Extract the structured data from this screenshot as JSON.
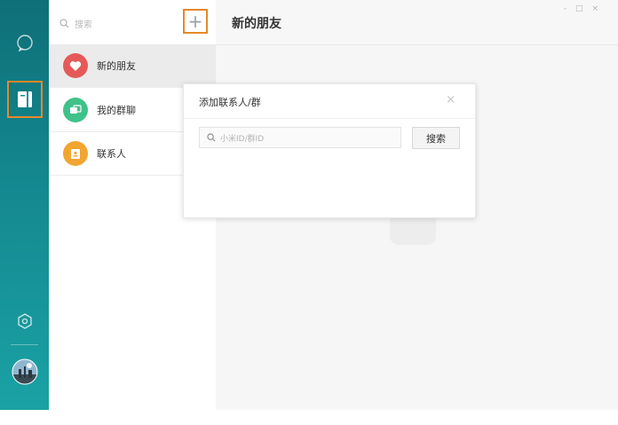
{
  "rail": {
    "icons": [
      "chat-bubble-icon",
      "contacts-book-icon",
      "settings-hexagon-icon",
      "avatar"
    ],
    "active": "contacts-book-icon",
    "gradient": [
      "#0f6f78",
      "#1aa2a4"
    ]
  },
  "contacts_panel": {
    "search_placeholder": "搜索",
    "add_button_label": "+",
    "items": [
      {
        "label": "新的朋友",
        "icon": "heart-icon",
        "color": "#e55a58",
        "selected": true
      },
      {
        "label": "我的群聊",
        "icon": "group-chat-icon",
        "color": "#3fc28a",
        "selected": false
      },
      {
        "label": "联系人",
        "icon": "contact-card-icon",
        "color": "#f2a531",
        "selected": false
      }
    ]
  },
  "main": {
    "title": "新的朋友",
    "window_controls": [
      "-",
      "□",
      "×"
    ]
  },
  "dialog": {
    "title": "添加联系人/群",
    "close_label": "×",
    "input_placeholder": "小米ID/群ID",
    "search_button_label": "搜索"
  },
  "colors": {
    "highlight": "#e6892a"
  }
}
